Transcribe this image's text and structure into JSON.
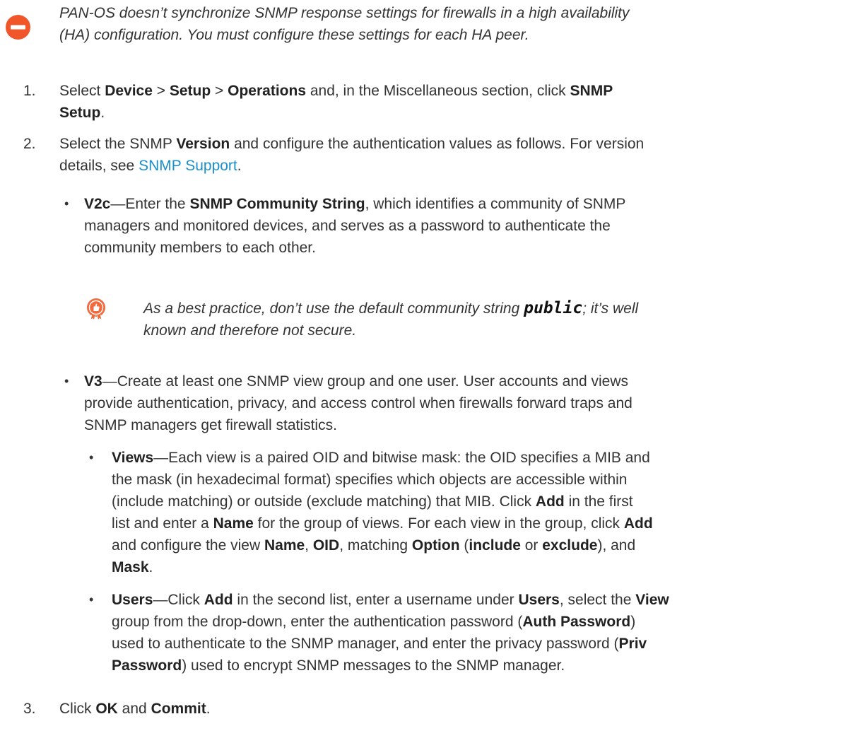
{
  "notes": {
    "caution": {
      "icon": "no-entry-icon",
      "lines": [
        "PAN-OS doesn’t synchronize SNMP response settings for firewalls in a high availability",
        "(HA) configuration. You must configure these settings for each HA peer."
      ]
    },
    "best_practice": {
      "icon": "best-practice-badge-icon",
      "prefix": "As a best practice, don’t use the default community string ",
      "code": "public",
      "suffix": "; it’s well",
      "line2": "known and therefore not secure."
    }
  },
  "steps": [
    {
      "number": "1.",
      "l1": {
        "a": "Select ",
        "b": "Device",
        "c": " > ",
        "d": "Setup",
        "e": " > ",
        "f": "Operations",
        "g": " and, in the Miscellaneous section, click ",
        "h": "SNMP"
      },
      "l2": {
        "a": "Setup",
        "b": "."
      }
    },
    {
      "number": "2.",
      "l1": {
        "a": "Select the SNMP ",
        "b": "Version",
        "c": " and configure the authentication values as follows. For version"
      },
      "l2": {
        "a": "details, see ",
        "link": "SNMP Support",
        "b": "."
      },
      "v2c": {
        "term": "V2c",
        "l1": "—Enter the ",
        "l1b": "SNMP Community String",
        "l1c": ", which identifies a community of SNMP",
        "l2": "managers and monitored devices, and serves as a password to authenticate the",
        "l3": "community members to each other."
      },
      "v3": {
        "term": "V3",
        "l1": "—Create at least one SNMP view group and one user. User accounts and views",
        "l2": "provide authentication, privacy, and access control when firewalls forward traps and",
        "l3": "SNMP managers get firewall statistics.",
        "views": {
          "term": "Views",
          "l1": "—Each view is a paired OID and bitwise mask: the OID specifies a MIB and",
          "l2": "the mask (in hexadecimal format) specifies which objects are accessible within",
          "l3a": "(include matching) or outside (exclude matching) that MIB. Click ",
          "l3b": "Add",
          "l3c": " in the first",
          "l4a": "list and enter a ",
          "l4b": "Name",
          "l4c": " for the group of views. For each view in the group, click ",
          "l4d": "Add",
          "l5a": "and configure the view ",
          "l5b": "Name",
          "l5c": ", ",
          "l5d": "OID",
          "l5e": ", matching ",
          "l5f": "Option",
          "l5g": " (",
          "l5h": "include",
          "l5i": " or ",
          "l5j": "exclude",
          "l5k": "), and",
          "l6a": "Mask",
          "l6b": "."
        },
        "users": {
          "term": "Users",
          "l1a": "—Click ",
          "l1b": "Add",
          "l1c": " in the second list, enter a username under ",
          "l1d": "Users",
          "l1e": ", select the ",
          "l1f": "View",
          "l2a": "group from the drop-down, enter the authentication password (",
          "l2b": "Auth Password",
          "l2c": ")",
          "l3a": "used to authenticate to the SNMP manager, and enter the privacy password (",
          "l3b": "Priv",
          "l4a": "Password",
          "l4b": ") used to encrypt SNMP messages to the SNMP manager."
        }
      }
    },
    {
      "number": "3.",
      "l1": {
        "a": "Click ",
        "b": "OK",
        "c": " and ",
        "d": "Commit",
        "e": "."
      }
    }
  ],
  "colors": {
    "caution_icon": "#f0562a",
    "badge_icon": "#f26a3d",
    "link": "#1a8fc9",
    "text": "#333333"
  }
}
